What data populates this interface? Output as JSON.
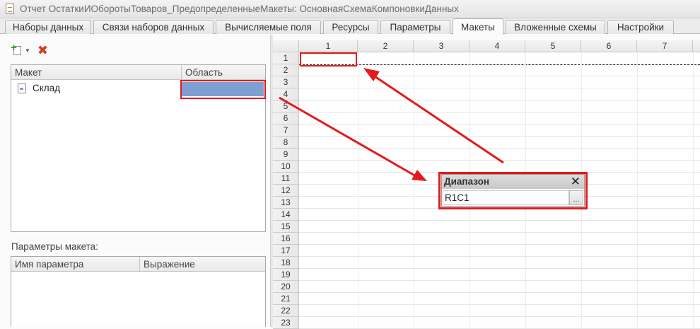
{
  "window": {
    "title": "Отчет ОстаткиИОборотыТоваров_ПредопределенныеМакеты: ОсновнаяСхемаКомпоновкиДанных"
  },
  "tabs": [
    {
      "label": "Наборы данных"
    },
    {
      "label": "Связи наборов данных"
    },
    {
      "label": "Вычисляемые поля"
    },
    {
      "label": "Ресурсы"
    },
    {
      "label": "Параметры"
    },
    {
      "label": "Макеты",
      "active": true
    },
    {
      "label": "Вложенные схемы"
    },
    {
      "label": "Настройки"
    }
  ],
  "layouts_table": {
    "columns": [
      "Макет",
      "Область"
    ],
    "rows": [
      {
        "name": "Склад",
        "area": ""
      }
    ]
  },
  "params": {
    "label": "Параметры макета:",
    "columns": [
      "Имя параметра",
      "Выражение"
    ]
  },
  "sheet": {
    "columns": [
      "1",
      "2",
      "3",
      "4",
      "5",
      "6",
      "7"
    ],
    "rows": [
      "1",
      "2",
      "3",
      "4",
      "5",
      "6",
      "7",
      "8",
      "9",
      "10",
      "11",
      "12",
      "13",
      "14",
      "15",
      "16",
      "17",
      "18",
      "19",
      "20",
      "21",
      "22",
      "23"
    ]
  },
  "range_popup": {
    "title": "Диапазон",
    "value": "R1C1",
    "button_label": "..."
  },
  "colors": {
    "highlight": "#e31a1a",
    "selected_area": "#7e9fd3"
  },
  "icons": [
    "document-icon",
    "add-icon",
    "delete-icon",
    "close-icon"
  ]
}
